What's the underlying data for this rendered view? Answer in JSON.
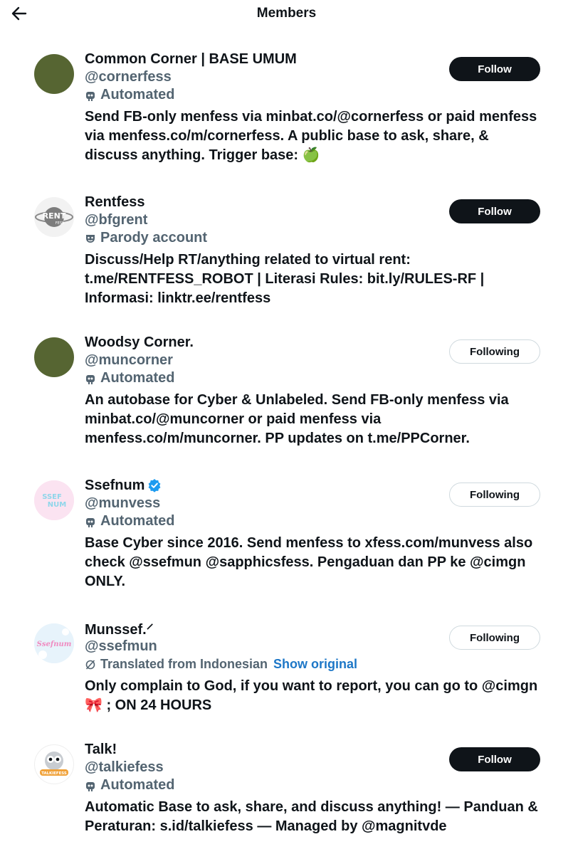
{
  "header": {
    "title": "Members"
  },
  "members": [
    {
      "name": "Common Corner | BASE UMUM",
      "handle": "@cornerfess",
      "label": "Automated",
      "bio": "Send FB-only menfess via minbat.co/@cornerfess or paid menfess via menfess.co/m/cornerfess. A public base to ask, share, & discuss anything. Trigger base: 🍏",
      "button": "Follow"
    },
    {
      "name": "Rentfess",
      "handle": "@bfgrent",
      "label": "Parody account",
      "avatar_text": "RENT",
      "avatar_subtext": "FESS",
      "bio": "Discuss/Help RT/anything related to virtual rent: t.me/RENTFESS_ROBOT | Literasi Rules: bit.ly/RULES-RF | Informasi: linktr.ee/rentfess",
      "button": "Follow"
    },
    {
      "name": "Woodsy Corner.",
      "handle": "@muncorner",
      "label": "Automated",
      "bio": "An autobase for Cyber & Unlabeled. Send FB-only menfess via minbat.co/@muncorner or paid menfess via menfess.co/m/muncorner. PP updates on t.me/PPCorner.",
      "button": "Following"
    },
    {
      "name": "Ssefnum",
      "handle": "@munvess",
      "label": "Automated",
      "avatar_text": "SSEF",
      "avatar_subtext": "NUM",
      "bio": "Base Cyber since 2016. Send menfess to xfess.com/munvess also check @ssefmun @sapphicsfess. Pengaduan dan PP ke @cimgn ONLY.",
      "button": "Following"
    },
    {
      "name": "Munssef.⸍",
      "handle": "@ssefmun",
      "label": "Translated from Indonesian",
      "show_original": "Show original",
      "avatar_text": "Ssefnum",
      "bio": "Only complain to God, if you want to report, you can go to @cimgn 🎀 ; ON 24 HOURS",
      "button": "Following"
    },
    {
      "name": "Talk!",
      "handle": "@talkiefess",
      "label": "Automated",
      "avatar_text": "TALKIEFESS",
      "bio": "Automatic Base to ask, share, and discuss anything! — Panduan & Peraturan: s.id/talkiefess — Managed by @magnitvde",
      "button": "Follow"
    }
  ],
  "colors": {
    "primary_text": "#0f1419",
    "secondary_text": "#536471",
    "link": "#1d77c7",
    "olive_avatar": "#566532",
    "verified": "#1d9bf0"
  },
  "icons": {
    "back": "arrow-left-icon",
    "automated": "robot-icon",
    "parody": "mask-icon",
    "translated": "translate-icon",
    "verified": "verified-badge-icon"
  }
}
